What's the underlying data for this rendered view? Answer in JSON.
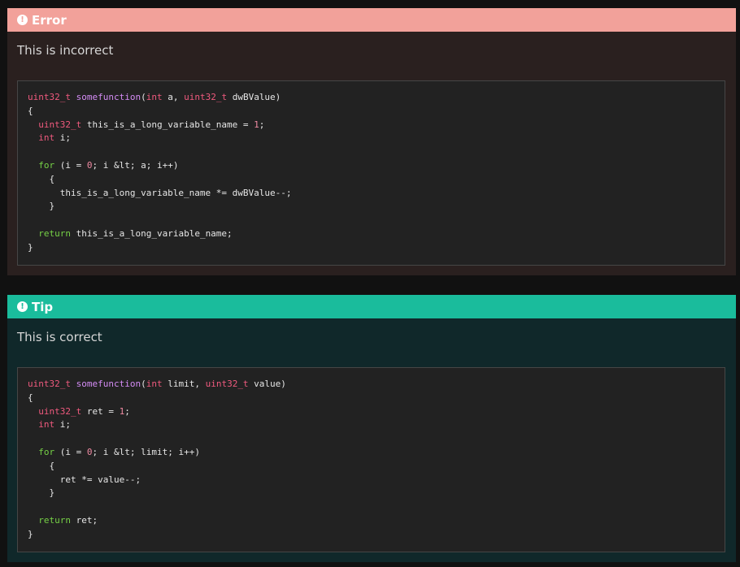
{
  "admonitions": [
    {
      "kind": "error",
      "title": "Error",
      "icon": "exclamation-circle-icon",
      "text": "This is incorrect",
      "code": [
        [
          [
            "type",
            "uint32_t"
          ],
          [
            "plain",
            " "
          ],
          [
            "func",
            "somefunction"
          ],
          [
            "plain",
            "("
          ],
          [
            "type",
            "int"
          ],
          [
            "plain",
            " a, "
          ],
          [
            "type",
            "uint32_t"
          ],
          [
            "plain",
            " dwBValue)"
          ]
        ],
        [
          [
            "plain",
            "{"
          ]
        ],
        [
          [
            "plain",
            "  "
          ],
          [
            "type",
            "uint32_t"
          ],
          [
            "plain",
            " this_is_a_long_variable_name = "
          ],
          [
            "num",
            "1"
          ],
          [
            "plain",
            ";"
          ]
        ],
        [
          [
            "plain",
            "  "
          ],
          [
            "type",
            "int"
          ],
          [
            "plain",
            " i;"
          ]
        ],
        [
          [
            "plain",
            ""
          ]
        ],
        [
          [
            "plain",
            "  "
          ],
          [
            "kw",
            "for"
          ],
          [
            "plain",
            " (i = "
          ],
          [
            "num",
            "0"
          ],
          [
            "plain",
            "; i &lt; a; i++)"
          ]
        ],
        [
          [
            "plain",
            "    {"
          ]
        ],
        [
          [
            "plain",
            "      this_is_a_long_variable_name *= dwBValue--;"
          ]
        ],
        [
          [
            "plain",
            "    }"
          ]
        ],
        [
          [
            "plain",
            ""
          ]
        ],
        [
          [
            "plain",
            "  "
          ],
          [
            "kw",
            "return"
          ],
          [
            "plain",
            " this_is_a_long_variable_name;"
          ]
        ],
        [
          [
            "plain",
            "}"
          ]
        ]
      ]
    },
    {
      "kind": "tip",
      "title": "Tip",
      "icon": "exclamation-circle-icon",
      "text": "This is correct",
      "code": [
        [
          [
            "type",
            "uint32_t"
          ],
          [
            "plain",
            " "
          ],
          [
            "func",
            "somefunction"
          ],
          [
            "plain",
            "("
          ],
          [
            "type",
            "int"
          ],
          [
            "plain",
            " limit, "
          ],
          [
            "type",
            "uint32_t"
          ],
          [
            "plain",
            " value)"
          ]
        ],
        [
          [
            "plain",
            "{"
          ]
        ],
        [
          [
            "plain",
            "  "
          ],
          [
            "type",
            "uint32_t"
          ],
          [
            "plain",
            " ret = "
          ],
          [
            "num",
            "1"
          ],
          [
            "plain",
            ";"
          ]
        ],
        [
          [
            "plain",
            "  "
          ],
          [
            "type",
            "int"
          ],
          [
            "plain",
            " i;"
          ]
        ],
        [
          [
            "plain",
            ""
          ]
        ],
        [
          [
            "plain",
            "  "
          ],
          [
            "kw",
            "for"
          ],
          [
            "plain",
            " (i = "
          ],
          [
            "num",
            "0"
          ],
          [
            "plain",
            "; i &lt; limit; i++)"
          ]
        ],
        [
          [
            "plain",
            "    {"
          ]
        ],
        [
          [
            "plain",
            "      ret *= value--;"
          ]
        ],
        [
          [
            "plain",
            "    }"
          ]
        ],
        [
          [
            "plain",
            ""
          ]
        ],
        [
          [
            "plain",
            "  "
          ],
          [
            "kw",
            "return"
          ],
          [
            "plain",
            " ret;"
          ]
        ],
        [
          [
            "plain",
            "}"
          ]
        ]
      ]
    }
  ],
  "colors": {
    "error_header": "#f2a19a",
    "error_body": "#2a201f",
    "tip_header": "#1abc9c",
    "tip_body": "#10282a",
    "code_bg": "#222222",
    "token_type": "#f05a7e",
    "token_func": "#d48cf5",
    "token_keyword": "#76d146",
    "token_number": "#ef8aa2"
  }
}
